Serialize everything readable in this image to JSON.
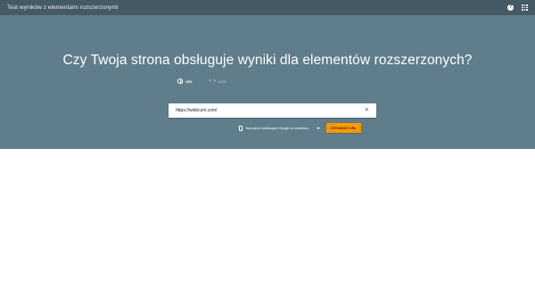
{
  "header": {
    "title": "Test wyników z elementami rozszerzonymi",
    "help_icon": "help-icon",
    "apps_icon": "apps-grid-icon",
    "help_glyph": "?"
  },
  "hero": {
    "headline": "Czy Twoja strona obsługuje wyniki dla elementów rozszerzonych?"
  },
  "tabs": [
    {
      "label": "URL",
      "icon": "globe-icon",
      "active": true
    },
    {
      "label": "KOD",
      "icon": "code-icon",
      "active": false
    }
  ],
  "url_input": {
    "value": "https://widoczni.com/",
    "clear_icon": "close-icon",
    "clear_glyph": "✕"
  },
  "device": {
    "label": "Narzędzie indeksujące Google na smartfony",
    "icon": "smartphone-icon",
    "arrow_icon": "dropdown-arrow-icon"
  },
  "action": {
    "test_label": "SPRAWDŹ URL"
  },
  "colors": {
    "topbar": "#455a64",
    "hero": "#607d8b",
    "accent": "#ff9800",
    "background": "#ffffff"
  }
}
